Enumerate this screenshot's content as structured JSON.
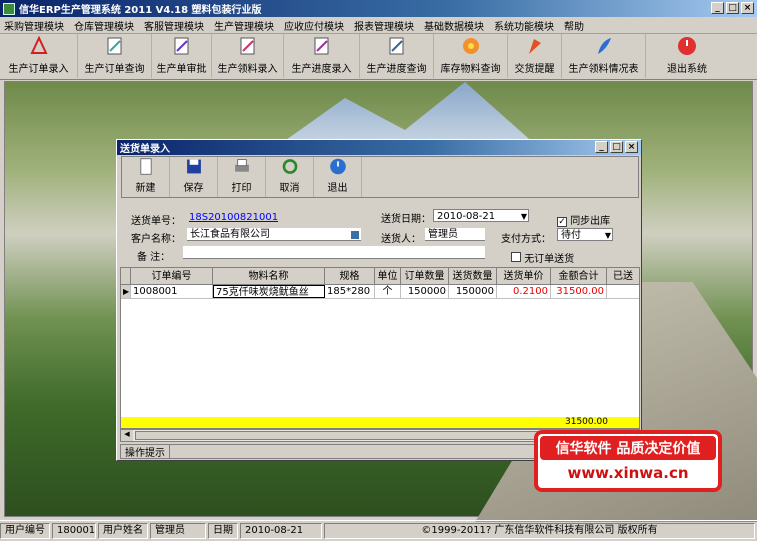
{
  "app": {
    "title": "信华ERP生产管理系统  2011 V4.18 塑料包装行业版"
  },
  "menu": [
    "采购管理模块",
    "仓库管理模块",
    "客服管理模块",
    "生产管理模块",
    "应收应付模块",
    "报表管理模块",
    "基础数据模块",
    "系统功能模块",
    "帮助"
  ],
  "toolbar": [
    "生产订单录入",
    "生产订单查询",
    "生产单审批",
    "生产领料录入",
    "生产进度录入",
    "生产进度查询",
    "库存物料查询",
    "交货提醒",
    "生产领料情况表",
    "退出系统"
  ],
  "dialog": {
    "title": "送货单录入",
    "toolbar": [
      "新建",
      "保存",
      "打印",
      "取消",
      "退出"
    ],
    "form": {
      "order_no_label": "送货单号：",
      "order_no": "18S20100821001",
      "date_label": "送货日期：",
      "date": "2010-08-21",
      "sync_label": "同步出库",
      "customer_label": "客户名称：",
      "customer": "长江食品有限公司",
      "deliverer_label": "送货人：",
      "deliverer": "管理员",
      "pay_label": "支付方式：",
      "pay": "待付",
      "noorder_label": "无订单送货",
      "remark_label": "备  注："
    },
    "grid": {
      "headers": [
        "订单编号",
        "物料名称",
        "规格",
        "单位",
        "订单数量",
        "送货数量",
        "送货单价",
        "金额合计",
        "已送"
      ],
      "rows": [
        [
          "1008001",
          "75克仟味炭烧鱿鱼丝",
          "185*280",
          "个",
          "150000",
          "150000",
          "0.2100",
          "31500.00",
          ""
        ]
      ],
      "total": "31500.00"
    },
    "status": "操作提示"
  },
  "statusbar": {
    "user_no_label": "用户编号",
    "user_no": "180001",
    "user_name_label": "用户姓名",
    "user_name": "管理员",
    "date_label": "日期",
    "date": "2010-08-21",
    "copyright": "©1999-2011?  广东信华软件科技有限公司    版权所有"
  },
  "watermark": {
    "line1": "信华软件 品质决定价值",
    "line2": "www.xinwa.cn"
  },
  "colors": {
    "titlebar": "#0a246a",
    "accent_red": "#e02020",
    "total_row": "#ffff00"
  }
}
